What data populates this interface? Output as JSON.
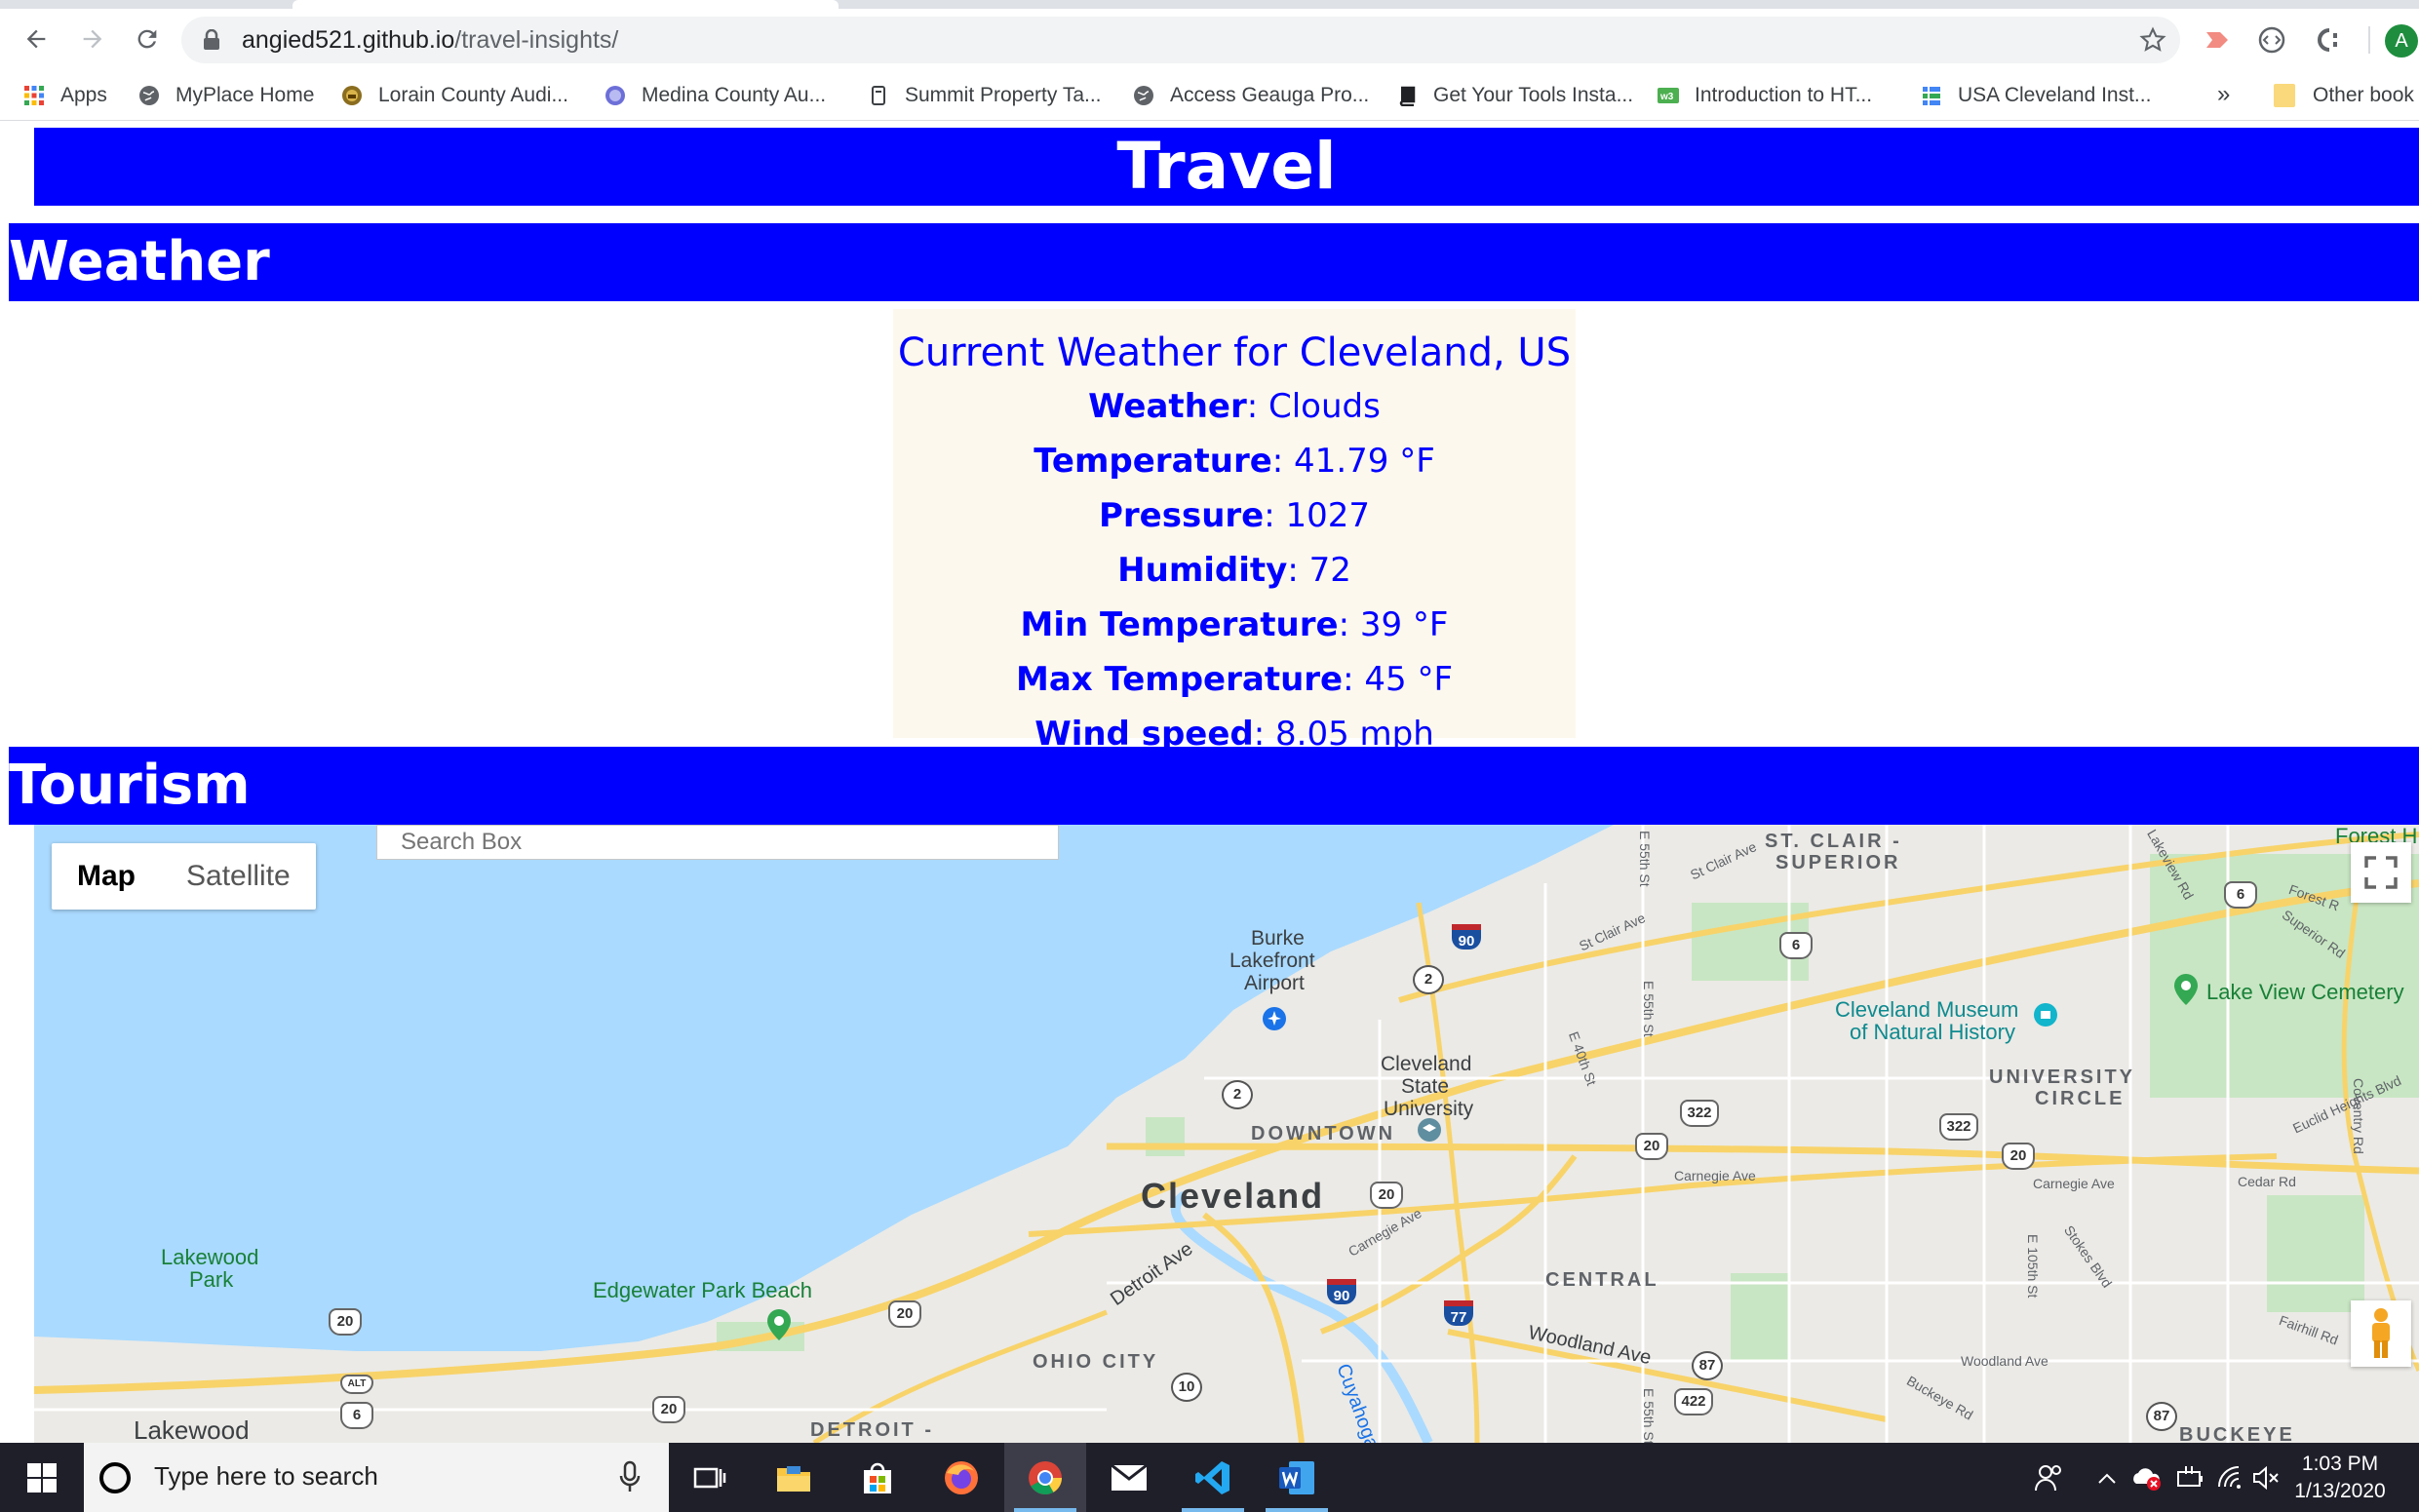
{
  "browser": {
    "url_host": "angied521.github.io",
    "url_path": "/travel-insights/",
    "bookmarks": [
      {
        "label": "Apps",
        "icon": "apps-grid-icon"
      },
      {
        "label": "MyPlace Home",
        "icon": "globe-icon"
      },
      {
        "label": "Lorain County Audi...",
        "icon": "county-seal-icon"
      },
      {
        "label": "Medina County Au...",
        "icon": "county-seal-icon"
      },
      {
        "label": "Summit Property Ta...",
        "icon": "document-icon"
      },
      {
        "label": "Access Geauga Pro...",
        "icon": "globe-icon"
      },
      {
        "label": "Get Your Tools Insta...",
        "icon": "book-icon"
      },
      {
        "label": "Introduction to HT...",
        "icon": "w3-icon"
      },
      {
        "label": "USA Cleveland Inst...",
        "icon": "sheet-icon"
      }
    ],
    "bookmarks_more": "»",
    "other_bookmarks": "Other book",
    "profile_initial": "A"
  },
  "page": {
    "title": "Travel",
    "weather_heading": "Weather",
    "weather_title": "Current Weather for Cleveland, US",
    "weather_rows": [
      {
        "label": "Weather",
        "value": ": Clouds"
      },
      {
        "label": "Temperature",
        "value": ": 41.79 °F"
      },
      {
        "label": "Pressure",
        "value": ": 1027"
      },
      {
        "label": "Humidity",
        "value": ": 72"
      },
      {
        "label": "Min Temperature",
        "value": ": 39 °F"
      },
      {
        "label": "Max Temperature",
        "value": ": 45 °F"
      },
      {
        "label": "Wind speed",
        "value": ": 8.05 mph"
      }
    ],
    "tourism_heading": "Tourism"
  },
  "map": {
    "type_buttons": {
      "map": "Map",
      "satellite": "Satellite"
    },
    "search_placeholder": "Search Box",
    "labels": {
      "city": "Cleveland",
      "downtown": "DOWNTOWN",
      "ohio_city": "OHIO CITY",
      "central": "CENTRAL",
      "st_clair_superior_1": "ST. CLAIR -",
      "st_clair_superior_2": "SUPERIOR",
      "university_circle_1": "UNIVERSITY",
      "university_circle_2": "CIRCLE",
      "detroit": "DETROIT -",
      "buckeye": "BUCKEYE",
      "lakewood": "Lakewood",
      "airport_1": "Burke",
      "airport_2": "Lakefront",
      "airport_3": "Airport",
      "csu_1": "Cleveland",
      "csu_2": "State",
      "csu_3": "University",
      "museum_1": "Cleveland Museum",
      "museum_2": "of Natural History",
      "lake_view": "Lake View Cemetery",
      "lakewood_park_1": "Lakewood",
      "lakewood_park_2": "Park",
      "edgewater": "Edgewater Park Beach",
      "forest_hill": "Forest H",
      "cuyahoga": "Cuyahoga Riv",
      "detroit_ave": "Detroit Ave",
      "woodland_ave": "Woodland Ave",
      "carnegie_ave_1": "Carnegie Ave",
      "carnegie_ave_2": "Carnegie Ave",
      "carnegie_ave_3": "Carnegie Ave",
      "woodland_ave_2": "Woodland Ave",
      "cedar_rd": "Cedar Rd",
      "fairhill_rd": "Fairhill Rd",
      "buckeye_rd": "Buckeye Rd",
      "euclid_heights": "Euclid Heights Blvd",
      "stokes_blvd": "Stokes Blvd",
      "st_clair_ave_1": "St Clair Ave",
      "st_clair_ave_2": "St Clair Ave",
      "e55_1": "E 55th St",
      "e55_2": "E 55th St",
      "e55_3": "E 55th St",
      "e40": "E 40th St",
      "e105": "E 105th St",
      "coventry": "Coventry Rd",
      "superior_rd": "Superior Rd",
      "forest_rd": "Forest R",
      "lakeview_rd": "Lakeview Rd"
    },
    "shields": [
      "90",
      "2",
      "2",
      "6",
      "6",
      "322",
      "322",
      "20",
      "20",
      "20",
      "20",
      "20",
      "20",
      "90",
      "77",
      "87",
      "87",
      "422",
      "10",
      "6",
      "ALT"
    ]
  },
  "taskbar": {
    "search_placeholder": "Type here to search",
    "time": "1:03 PM",
    "date": "1/13/2020"
  }
}
